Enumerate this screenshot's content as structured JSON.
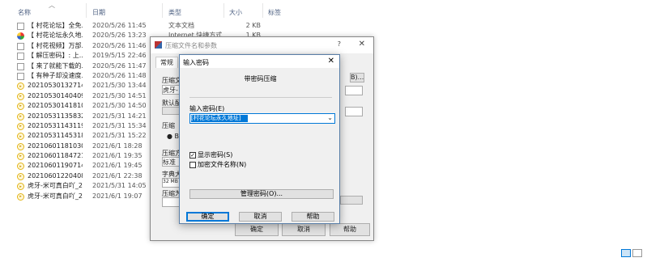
{
  "explorer": {
    "columns": {
      "name": "名称",
      "date": "日期",
      "type": "类型",
      "size": "大小",
      "tags": "标签"
    },
    "files": [
      {
        "icon": "text-file-icon",
        "name": "【 村花论坛】全免...",
        "date": "2020/5/26 11:45",
        "type": "文本文档",
        "size": "2 KB"
      },
      {
        "icon": "internet-shortcut-icon",
        "name": "【 村花论坛永久地...",
        "date": "2020/5/26 13:23",
        "type": "Internet 快捷方式",
        "size": "1 KB"
      },
      {
        "icon": "text-file-icon",
        "name": "【 村花视频】万部...",
        "date": "2020/5/26 11:46",
        "type": "",
        "size": ""
      },
      {
        "icon": "text-file-icon",
        "name": "【 解压密码】: 上...",
        "date": "2019/5/15 22:46",
        "type": "",
        "size": ""
      },
      {
        "icon": "text-file-icon",
        "name": "【 来了就能下载的...",
        "date": "2020/5/26 11:47",
        "type": "",
        "size": ""
      },
      {
        "icon": "text-file-icon",
        "name": "【 有种子却没速度...",
        "date": "2020/5/26 11:48",
        "type": "",
        "size": ""
      },
      {
        "icon": "video-file-icon",
        "name": "20210530132714_...",
        "date": "2021/5/30 13:44",
        "type": "",
        "size": ""
      },
      {
        "icon": "video-file-icon",
        "name": "20210530140409_...",
        "date": "2021/5/30 14:51",
        "type": "",
        "size": ""
      },
      {
        "icon": "video-file-icon",
        "name": "20210530141810_...",
        "date": "2021/5/30 14:50",
        "type": "",
        "size": ""
      },
      {
        "icon": "video-file-icon",
        "name": "20210531135832_...",
        "date": "2021/5/31 14:21",
        "type": "",
        "size": ""
      },
      {
        "icon": "video-file-icon",
        "name": "20210531143119_...",
        "date": "2021/5/31 15:34",
        "type": "",
        "size": ""
      },
      {
        "icon": "video-file-icon",
        "name": "20210531145318_...",
        "date": "2021/5/31 15:22",
        "type": "",
        "size": ""
      },
      {
        "icon": "video-file-icon",
        "name": "20210601181030_...",
        "date": "2021/6/1 18:28",
        "type": "",
        "size": ""
      },
      {
        "icon": "video-file-icon",
        "name": "20210601184721_...",
        "date": "2021/6/1 19:35",
        "type": "",
        "size": ""
      },
      {
        "icon": "video-file-icon",
        "name": "20210601190714_...",
        "date": "2021/6/1 19:45",
        "type": "",
        "size": ""
      },
      {
        "icon": "video-file-icon",
        "name": "20210601220408_...",
        "date": "2021/6/1 22:38",
        "type": "",
        "size": ""
      },
      {
        "icon": "video-file-icon",
        "name": "虎牙-米可真白吖_2...",
        "date": "2021/5/31 14:05",
        "type": "",
        "size": ""
      },
      {
        "icon": "video-file-icon",
        "name": "虎牙-米可真白吖_2...",
        "date": "2021/6/1 19:07",
        "type": "",
        "size": ""
      }
    ]
  },
  "archive_dialog": {
    "title": "压缩文件名和参数",
    "help_mark": "?",
    "tab_general": "常规",
    "label_archive": "压缩文",
    "archive_value": "虎牙-",
    "label_default": "默认配",
    "label_update": "压缩",
    "label_format": "压缩方",
    "format_value": "标准",
    "label_dict": "字典大",
    "dict_value": "32 MB",
    "label_split": "压缩为",
    "browse_label": "B)...",
    "radio_label": "● BA",
    "ok": "确定",
    "cancel": "取消",
    "help": "帮助"
  },
  "password_dialog": {
    "title": "输入密码",
    "group_title": "带密码压缩",
    "password_label": "输入密码(E)",
    "password_value": "[村花论坛永久地址]",
    "show_password": {
      "label": "显示密码(S)",
      "checked": true
    },
    "encrypt_names": {
      "label": "加密文件名称(N)",
      "checked": false
    },
    "manage_button": "管理密码(O)...",
    "ok": "确定",
    "cancel": "取消",
    "help": "帮助"
  }
}
